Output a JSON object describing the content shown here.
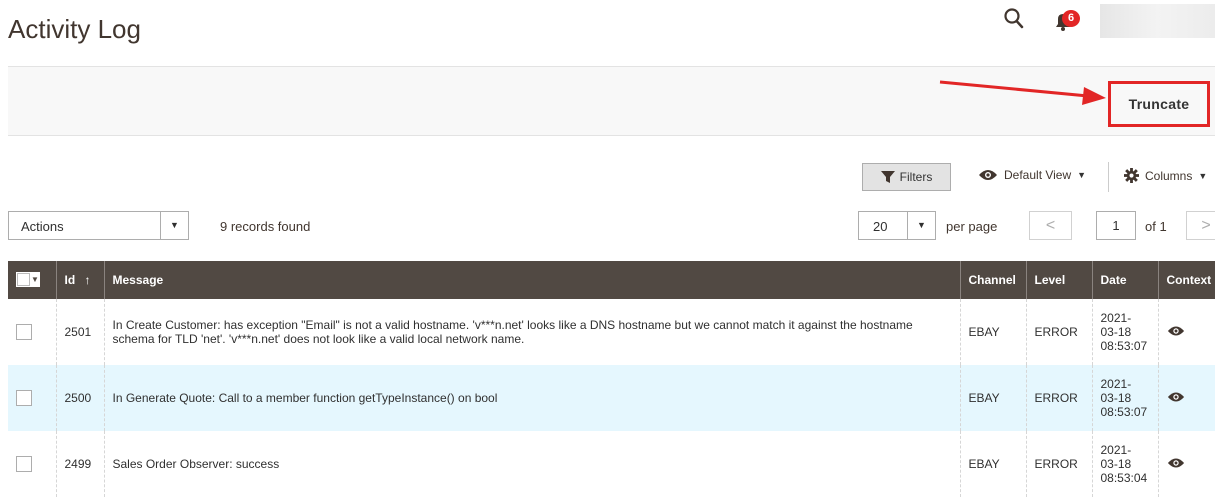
{
  "header": {
    "title": "Activity Log",
    "notification_count": "6",
    "icons": {
      "search": "search-icon",
      "notifications": "bell-icon",
      "user": "user-menu"
    }
  },
  "page_actions": {
    "truncate_label": "Truncate"
  },
  "toolbar": {
    "filters_label": "Filters",
    "view_label": "Default View",
    "columns_label": "Columns",
    "actions_select": "Actions",
    "records_found": "9 records found",
    "per_page_value": "20",
    "per_page_label": "per page",
    "prev_symbol": "<",
    "next_symbol": ">",
    "page_value": "1",
    "of_label": "of 1"
  },
  "table": {
    "headers": {
      "id": "Id",
      "sort": "↑",
      "message": "Message",
      "channel": "Channel",
      "level": "Level",
      "date": "Date",
      "context": "Context"
    },
    "rows": [
      {
        "id": "2501",
        "message": "In Create Customer: has exception \"Email\" is not a valid hostname. 'v***n.net' looks like a DNS hostname but we cannot match it against the hostname schema for TLD 'net'. 'v***n.net' does not look like a valid local network name.",
        "channel": "EBAY",
        "level": "ERROR",
        "date_1": "2021-",
        "date_2": "03-18",
        "date_3": "08:53:07"
      },
      {
        "id": "2500",
        "message": "In Generate Quote: Call to a member function getTypeInstance() on bool",
        "channel": "EBAY",
        "level": "ERROR",
        "date_1": "2021-",
        "date_2": "03-18",
        "date_3": "08:53:07"
      },
      {
        "id": "2499",
        "message": "Sales Order Observer: success",
        "channel": "EBAY",
        "level": "ERROR",
        "date_1": "2021-",
        "date_2": "03-18",
        "date_3": "08:53:04"
      }
    ]
  },
  "colors": {
    "header_bg": "#514943",
    "highlight_row": "#e5f7fe",
    "annotation_red": "#e22626",
    "badge": "#e22626"
  }
}
